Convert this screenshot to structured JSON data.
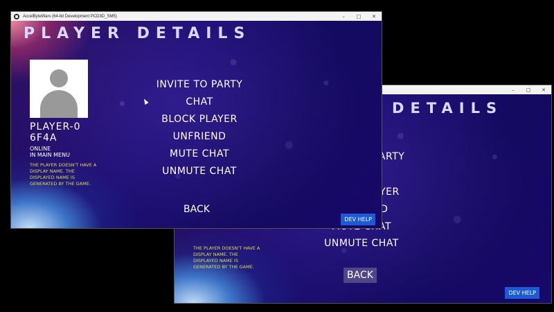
{
  "window": {
    "title": "AccelByteWars (64-bit Development PCD3D_SM5)",
    "minimize": "–",
    "maximize": "□",
    "close": "✕"
  },
  "page": {
    "title": "Player Details"
  },
  "player": {
    "name_line1": "PLAYER-0",
    "name_line2": "6F4A",
    "status_line1": "ONLINE",
    "status_line2": "IN MAIN MENU",
    "note": "THE PLAYER DOESN'T HAVE A DISPLAY NAME. THE DISPLAYED NAME IS GENERATED BY THE GAME."
  },
  "menu": {
    "invite": "INVITE TO PARTY",
    "chat": "CHAT",
    "block": "BLOCK PLAYER",
    "unfriend": "UNFRIEND",
    "mute": "MUTE CHAT",
    "unmute": "UNMUTE CHAT",
    "back": "BACK"
  },
  "dev_help": "DEV HELP",
  "icons": {
    "avatar": "person-silhouette-icon",
    "app": "app-logo-icon"
  }
}
